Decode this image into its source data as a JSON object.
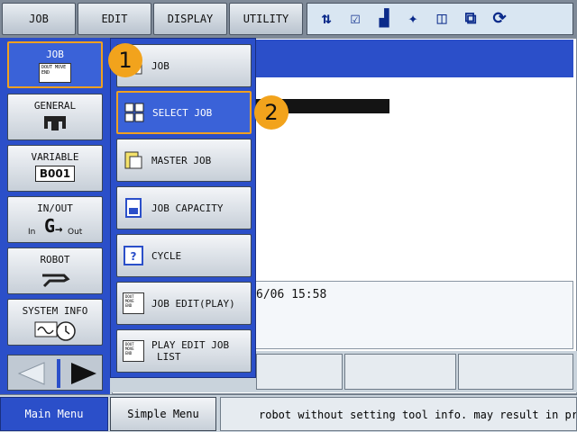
{
  "topbar": {
    "items": [
      {
        "label": "JOB"
      },
      {
        "label": "EDIT"
      },
      {
        "label": "DISPLAY"
      },
      {
        "label": "UTILITY"
      }
    ],
    "status_icons": [
      "coordinate-icon",
      "edit-mode-icon",
      "signal-level-icon",
      "robot-icon",
      "cycle-icon",
      "output-icon",
      "program-icon"
    ]
  },
  "workspace": {
    "datetime_fragment": "6/06 15:58"
  },
  "main_menu": {
    "items": [
      {
        "label": "JOB",
        "icon": "job-document-icon",
        "icon_text": "DOUT MOVE END"
      },
      {
        "label": "GENERAL",
        "icon": "tool-icon"
      },
      {
        "label": "VARIABLE",
        "icon_text": "B001"
      },
      {
        "label": "IN/OUT",
        "icon_in": "In",
        "icon_out": "Out"
      },
      {
        "label": "ROBOT",
        "icon": "robot-arm-icon"
      },
      {
        "label": "SYSTEM INFO",
        "icon": "clock-wave-icon"
      }
    ]
  },
  "submenu": {
    "items": [
      {
        "label": "JOB"
      },
      {
        "label": "SELECT JOB"
      },
      {
        "label": "MASTER JOB"
      },
      {
        "label": "JOB CAPACITY"
      },
      {
        "label": "CYCLE"
      },
      {
        "label": "JOB EDIT(PLAY)",
        "icon_text": "DOUT MOVE END"
      },
      {
        "label_line1": "PLAY EDIT JOB",
        "label_line2": "LIST",
        "icon_text": "DOUT MOVE END"
      }
    ]
  },
  "callouts": {
    "first": "1",
    "second": "2"
  },
  "bottombar": {
    "main_menu": "Main Menu",
    "simple_menu": "Simple Menu",
    "message": "robot without setting tool info. may result in pr"
  },
  "colors": {
    "menu_blue": "#2b4fc9",
    "highlight_orange": "#f2a31c"
  }
}
